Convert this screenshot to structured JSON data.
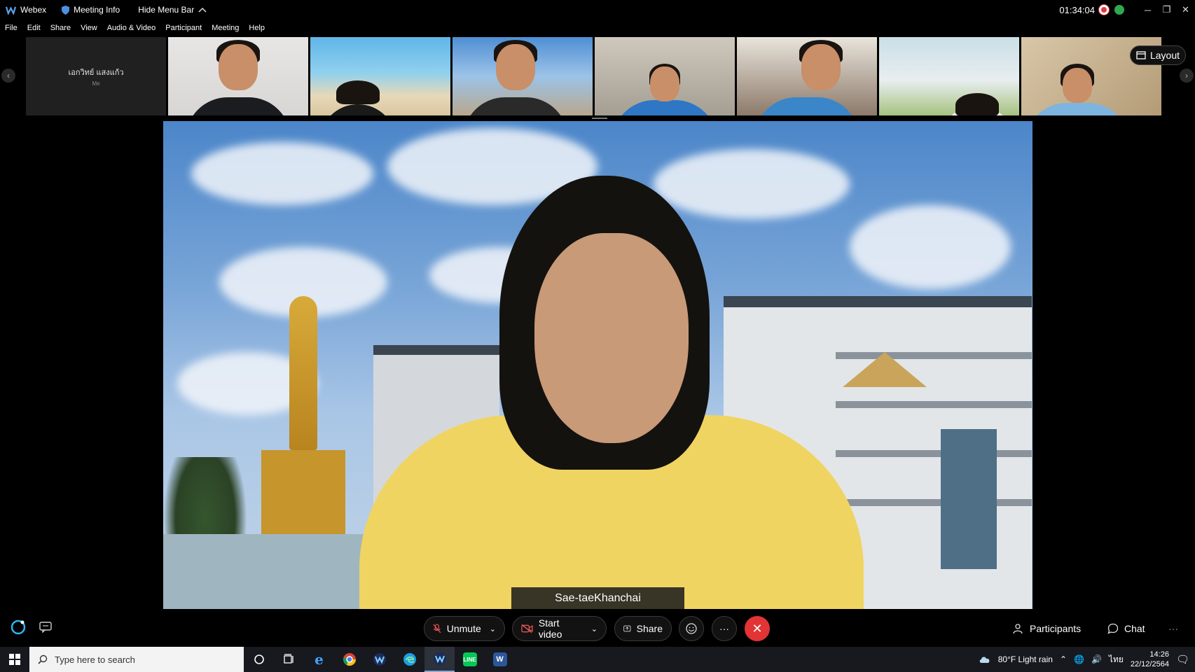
{
  "titlebar": {
    "app_name": "Webex",
    "meeting_info": "Meeting Info",
    "hide_menu": "Hide Menu Bar",
    "timer": "01:34:04"
  },
  "menu": [
    "File",
    "Edit",
    "Share",
    "View",
    "Audio & Video",
    "Participant",
    "Meeting",
    "Help"
  ],
  "filmstrip": {
    "self_name": "เอกวิทย์ แสงแก้ว",
    "self_sub": "Me",
    "layout_label": "Layout"
  },
  "main_video": {
    "speaker_name": "Sae-taeKhanchai"
  },
  "controls": {
    "unmute": "Unmute",
    "start_video": "Start video",
    "share": "Share",
    "more": "···",
    "participants": "Participants",
    "chat": "Chat"
  },
  "taskbar": {
    "search_placeholder": "Type here to search",
    "weather": "80°F  Light rain",
    "lang": "ไทย",
    "time": "14:26",
    "date": "22/12/2564"
  },
  "colors": {
    "end_call": "#e23434",
    "record": "#e03a3e",
    "status_green": "#2fa84f"
  }
}
